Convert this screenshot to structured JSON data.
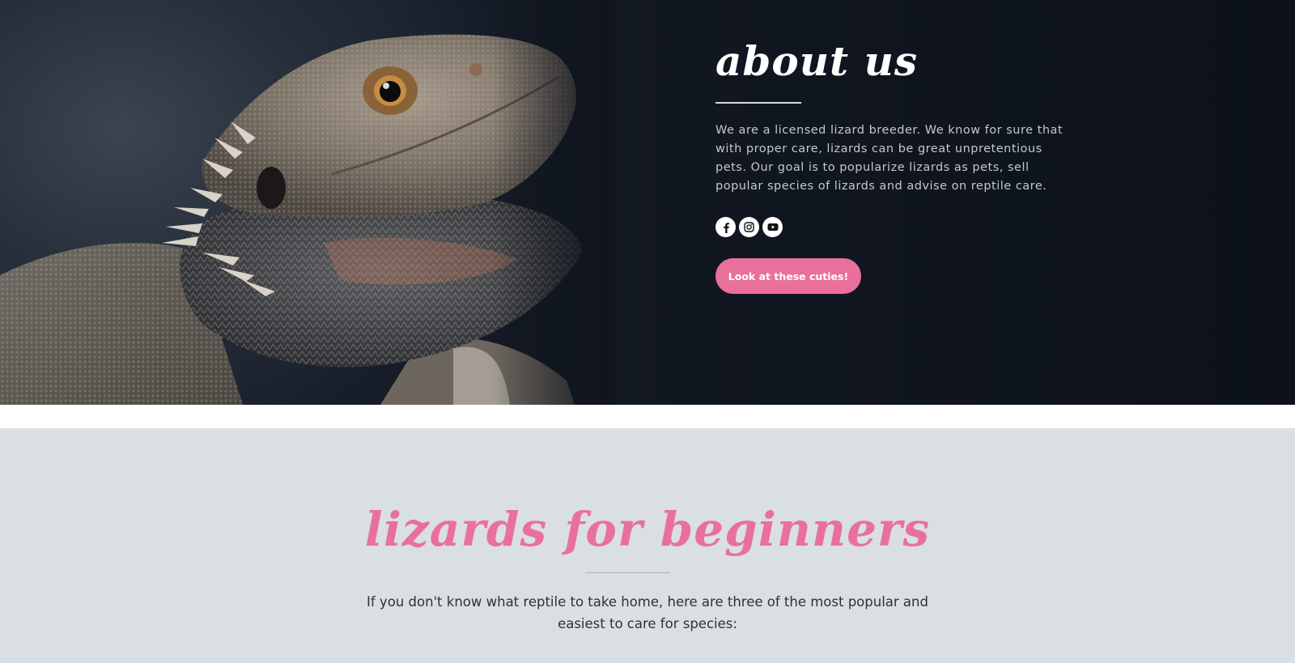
{
  "about": {
    "title": "about us",
    "description": "We are a licensed lizard breeder. We know for sure that with proper care, lizards can be great unpretentious pets. Our goal is to popularize lizards as pets, sell popular species of lizards and advise on reptile care.",
    "socials": [
      {
        "icon": "facebook-icon"
      },
      {
        "icon": "instagram-icon"
      },
      {
        "icon": "youtube-icon"
      }
    ],
    "cta_label": "Look at these cuties!"
  },
  "beginners": {
    "title": "lizards for beginners",
    "intro": "If you don't know what reptile to take home, here are three of the most popular and easiest to care for species:"
  },
  "colors": {
    "accent_pink": "#e9709b",
    "hero_bg": "#0f141d",
    "section_bg": "#d9dfe2"
  }
}
